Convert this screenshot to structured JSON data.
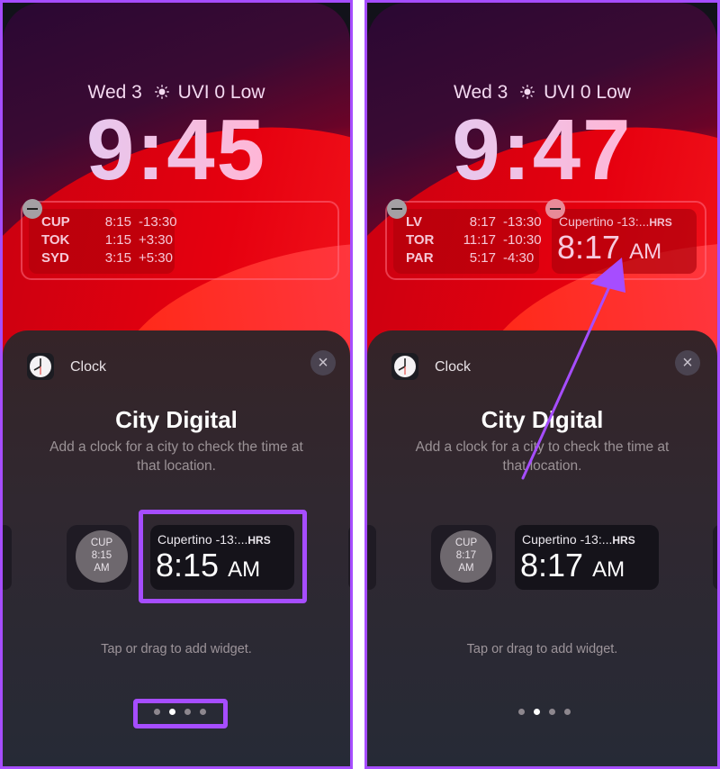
{
  "colors": {
    "annotation": "#a64dff",
    "wallpaper_red": "#e10a14",
    "sheet_bg": "#302830"
  },
  "panels": [
    {
      "lockscreen": {
        "date_label": "Wed 3",
        "weather_icon": "sun-icon",
        "weather_label": "UVI 0 Low",
        "time": "9:45",
        "world_clock_widget": {
          "rows": [
            {
              "city": "CUP",
              "time": "8:15",
              "offset": "-13:30"
            },
            {
              "city": "TOK",
              "time": "1:15",
              "offset": "+3:30"
            },
            {
              "city": "SYD",
              "time": "3:15",
              "offset": "+5:30"
            }
          ]
        }
      },
      "sheet": {
        "app_name": "Clock",
        "close_icon": "×",
        "title": "City Digital",
        "description": "Add a clock for a city to check the time at that location.",
        "preview_circular": {
          "line1": "CUP",
          "line2": "8:15",
          "line3": "AM"
        },
        "preview_rect": {
          "city": "Cupertino -13:...",
          "suffix": "HRS",
          "time": "8:15",
          "ampm": "AM"
        },
        "hint": "Tap or drag to add widget.",
        "page_count": 4,
        "current_page": 2
      }
    },
    {
      "lockscreen": {
        "date_label": "Wed 3",
        "weather_icon": "sun-icon",
        "weather_label": "UVI 0 Low",
        "time": "9:47",
        "world_clock_widget": {
          "rows": [
            {
              "city": "LV",
              "time": "8:17",
              "offset": "-13:30"
            },
            {
              "city": "TOR",
              "time": "11:17",
              "offset": "-10:30"
            },
            {
              "city": "PAR",
              "time": "5:17",
              "offset": "-4:30"
            }
          ]
        },
        "added_widget": {
          "city": "Cupertino -13:...",
          "suffix": "HRS",
          "time": "8:17",
          "ampm": "AM"
        }
      },
      "sheet": {
        "app_name": "Clock",
        "close_icon": "×",
        "title": "City Digital",
        "description": "Add a clock for a city to check the time at that location.",
        "preview_circular": {
          "line1": "CUP",
          "line2": "8:17",
          "line3": "AM"
        },
        "preview_rect": {
          "city": "Cupertino -13:...",
          "suffix": "HRS",
          "time": "8:17",
          "ampm": "AM"
        },
        "hint": "Tap or drag to add widget.",
        "page_count": 4,
        "current_page": 2
      }
    }
  ]
}
